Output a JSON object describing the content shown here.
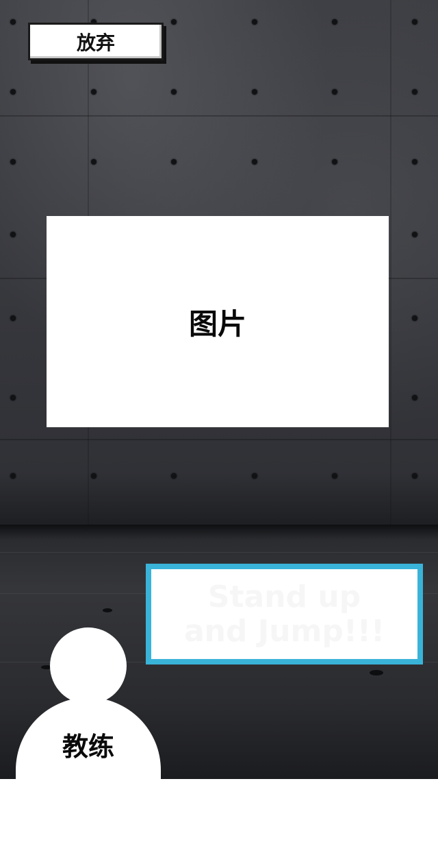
{
  "toolbar": {
    "give_up_label": "放弃"
  },
  "picture": {
    "placeholder_label": "图片"
  },
  "dialogue": {
    "text": "Stand up\nand Jump!!!"
  },
  "coach": {
    "label": "教练"
  },
  "colors": {
    "speech_border": "#3ab3d9",
    "panel": "#ffffff",
    "wall": "#38393e"
  }
}
